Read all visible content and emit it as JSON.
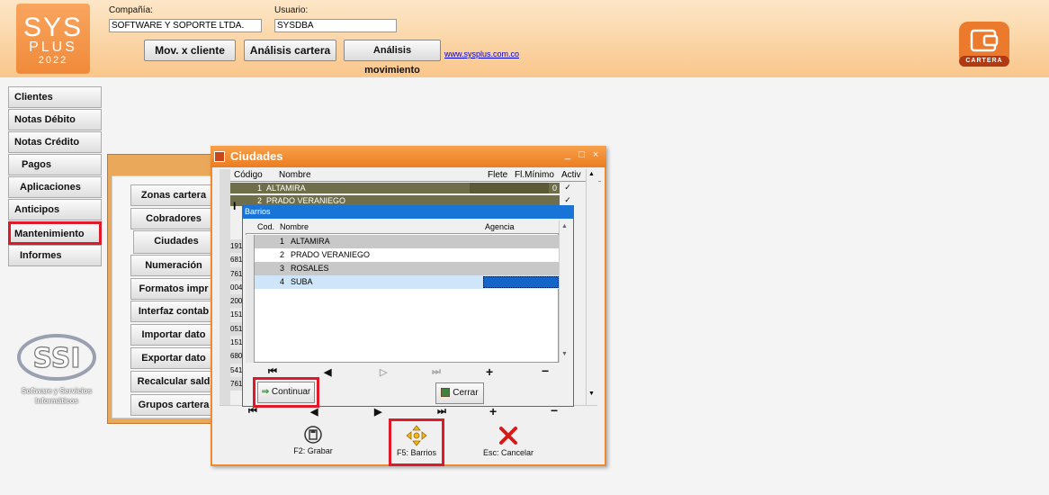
{
  "header": {
    "logo": {
      "line1": "SYS",
      "line2": "PLUS",
      "line3": "2022"
    },
    "company_label": "Compañía:",
    "company_value": "SOFTWARE Y SOPORTE LTDA.",
    "user_label": "Usuario:",
    "user_value": "SYSDBA",
    "buttons": [
      "Mov. x cliente",
      "Análisis cartera",
      "Análisis movimiento"
    ],
    "link": "www.sysplus.com.co",
    "module_badge": "CARTERA"
  },
  "sidebar": {
    "items": [
      "Clientes",
      "Notas Débito",
      "Notas Crédito",
      "Pagos",
      "Aplicaciones",
      "Anticipos",
      "Mantenimiento",
      "Informes"
    ],
    "selected": "Mantenimiento",
    "brand_text": "Software y Servicios Informáticos"
  },
  "mantenimiento": {
    "items": [
      "Zonas cartera",
      "Cobradores",
      "Ciudades",
      "Numeración",
      "Formatos impr",
      "Interfaz contab",
      "Importar dato",
      "Exportar dato",
      "Recalcular sald",
      "Grupos cartera"
    ],
    "selected": "Ciudades"
  },
  "ciudades": {
    "title": "Ciudades",
    "columns": [
      "Código",
      "Nombre",
      "Flete",
      "Fl.Mínimo",
      "Activ"
    ],
    "rows": [
      {
        "codigo": "1",
        "nombre": "ALTAMIRA",
        "flete": "",
        "fl_minimo": "0",
        "activo": "✓"
      },
      {
        "codigo": "2",
        "nombre": "PRADO VERANIEGO",
        "flete": "",
        "fl_minimo": "0",
        "activo": "✓"
      }
    ],
    "left_codes": [
      "191",
      "681",
      "761",
      "004",
      "200",
      "151",
      "051",
      "151",
      "680",
      "541",
      "761"
    ],
    "bottom_buttons": [
      {
        "label": "F2: Grabar",
        "icon": "save-icon"
      },
      {
        "label": "F5: Barrios",
        "icon": "move-arrows-icon"
      },
      {
        "label": "Esc: Cancelar",
        "icon": "cancel-x-icon"
      }
    ]
  },
  "barrios": {
    "title": "Barrios",
    "columns": [
      "Cod.",
      "Nombre",
      "Agencia"
    ],
    "rows": [
      {
        "cod": "1",
        "nombre": "ALTAMIRA",
        "agencia": ""
      },
      {
        "cod": "2",
        "nombre": "PRADO VERANIEGO",
        "agencia": ""
      },
      {
        "cod": "3",
        "nombre": "ROSALES",
        "agencia": ""
      },
      {
        "cod": "4",
        "nombre": "SUBA",
        "agencia": ""
      }
    ],
    "new_row_marker": "*",
    "continue_label": "Continuar",
    "close_label": "Cerrar"
  }
}
